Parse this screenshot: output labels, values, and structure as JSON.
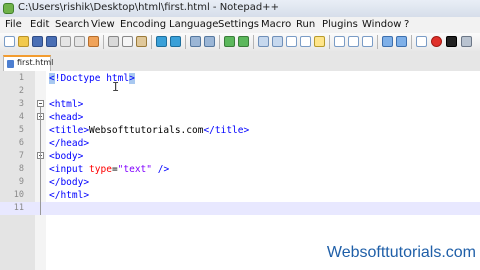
{
  "window": {
    "title": "C:\\Users\\rishik\\Desktop\\html\\first.html - Notepad++"
  },
  "menu": [
    "File",
    "Edit",
    "Search",
    "View",
    "Encoding",
    "Language",
    "Settings",
    "Macro",
    "Run",
    "Plugins",
    "Window",
    "?"
  ],
  "tab": {
    "label": "first.html"
  },
  "editor": {
    "line_numbers": [
      "1",
      "2",
      "3",
      "4",
      "5",
      "6",
      "7",
      "8",
      "9",
      "10",
      "11"
    ],
    "current_line": 11
  },
  "code": {
    "l1_open": "<",
    "l1_doctype": "!Doctype html",
    "l1_close": ">",
    "l3": "<html>",
    "l4": "<head>",
    "l5_open": "<title>",
    "l5_text": "Websofttutorials.com",
    "l5_close": "</title>",
    "l6": "</head>",
    "l7": "<body>",
    "l8_tag": "<input ",
    "l8_attr": "type",
    "l8_eq": "=",
    "l8_val": "\"text\"",
    "l8_end": " />",
    "l9": "</body>",
    "l10": "</html>"
  },
  "cursor_glyph": "I",
  "watermark": "Websofttutorials.com",
  "colors": {
    "tag": "#0000ff",
    "attribute": "#ff0000",
    "string": "#8000ff",
    "current_line": "#e8e8ff",
    "selection": "#a8c8f0"
  }
}
